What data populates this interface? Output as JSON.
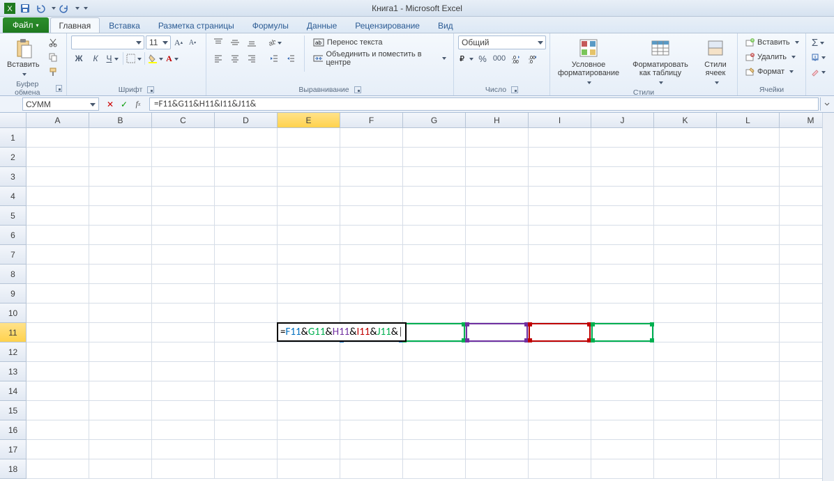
{
  "title": "Книга1 - Microsoft Excel",
  "tabs": {
    "file": "Файл",
    "home": "Главная",
    "insert": "Вставка",
    "pagelayout": "Разметка страницы",
    "formulas": "Формулы",
    "data": "Данные",
    "review": "Рецензирование",
    "view": "Вид"
  },
  "ribbon": {
    "clipboard": {
      "label": "Буфер обмена",
      "paste": "Вставить"
    },
    "font": {
      "label": "Шрифт",
      "name": "",
      "size": "11",
      "bold": "Ж",
      "italic": "К",
      "underline": "Ч"
    },
    "alignment": {
      "label": "Выравнивание",
      "wrap": "Перенос текста",
      "merge": "Объединить и поместить в центре"
    },
    "number": {
      "label": "Число",
      "format": "Общий"
    },
    "styles": {
      "label": "Стили",
      "cond": "Условное форматирование",
      "table": "Форматировать как таблицу",
      "cell": "Стили ячеек"
    },
    "cells": {
      "label": "Ячейки",
      "insert": "Вставить",
      "delete": "Удалить",
      "format": "Формат"
    },
    "editing": {
      "label": ""
    }
  },
  "formula_bar": {
    "name_box": "СУММ",
    "formula": "=F11&G11&H11&I11&J11&"
  },
  "columns": [
    "A",
    "B",
    "C",
    "D",
    "E",
    "F",
    "G",
    "H",
    "I",
    "J",
    "K",
    "L",
    "M"
  ],
  "rows_visible": 18,
  "active": {
    "col": "E",
    "row": 11
  },
  "cell_formula_parts": [
    {
      "t": "=",
      "c": "#000"
    },
    {
      "t": "F11",
      "c": "#0070c0"
    },
    {
      "t": "&",
      "c": "#000"
    },
    {
      "t": "G11",
      "c": "#00b050"
    },
    {
      "t": "&",
      "c": "#000"
    },
    {
      "t": "H11",
      "c": "#7030a0"
    },
    {
      "t": "&",
      "c": "#000"
    },
    {
      "t": "I11",
      "c": "#c00000"
    },
    {
      "t": "&",
      "c": "#000"
    },
    {
      "t": "J11",
      "c": "#00b050"
    },
    {
      "t": "&",
      "c": "#000"
    }
  ],
  "ref_boxes": [
    {
      "col": "F",
      "color": "#0070c0"
    },
    {
      "col": "G",
      "color": "#00b050"
    },
    {
      "col": "H",
      "color": "#7030a0"
    },
    {
      "col": "I",
      "color": "#c00000"
    },
    {
      "col": "J",
      "color": "#00b050"
    }
  ]
}
